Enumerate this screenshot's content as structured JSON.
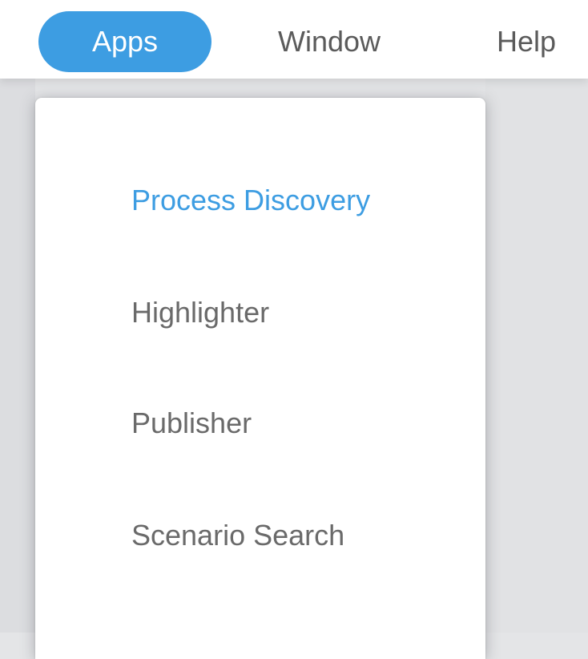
{
  "menubar": {
    "items": [
      {
        "label": "Apps",
        "active": true
      },
      {
        "label": "Window",
        "active": false
      },
      {
        "label": "Help",
        "active": false
      }
    ]
  },
  "dropdown": {
    "items": [
      {
        "label": "Process Discovery",
        "highlighted": true
      },
      {
        "label": "Highlighter",
        "highlighted": false
      },
      {
        "label": "Publisher",
        "highlighted": false
      },
      {
        "label": "Scenario Search",
        "highlighted": false
      }
    ]
  },
  "colors": {
    "accent": "#3d9de2",
    "menu_text": "#5b5b5b",
    "item_text": "#6a6a6a",
    "background": "#e4e5e7"
  }
}
